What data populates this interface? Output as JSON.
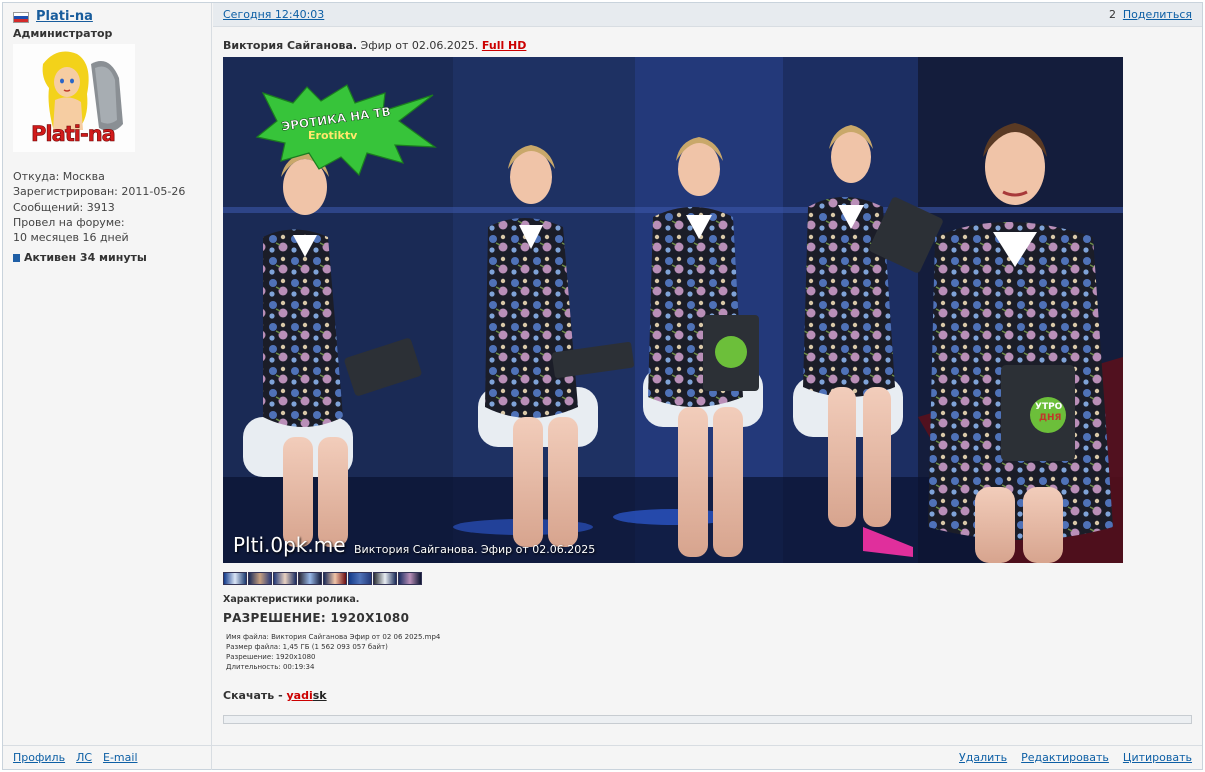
{
  "user": {
    "name": "Plati-na",
    "role": "Администратор",
    "avatar_text": "Plati-na",
    "info": [
      "Откуда: Москва",
      "Зарегистрирован: 2011-05-26",
      "Сообщений: 3913",
      "Провел на форуме:",
      "10 месяцев 16 дней"
    ],
    "active": "Активен 34 минуты"
  },
  "post": {
    "date": "Сегодня 12:40:03",
    "number": "2",
    "share": "Поделиться",
    "title_bold": "Виктория Сайганова.",
    "title_rest": " Эфир от 02.06.2025. ",
    "title_hd": "Full HD",
    "video": {
      "logo_top": "ЭРОТИКА НА ТВ",
      "logo_bottom": "Erotiktv",
      "watermark": "Plti.0pk.me",
      "caption": "Виктория Сайганова. Эфир от 02.06.2025",
      "tablet_text_1": "УТРО",
      "tablet_text_2": "ДНЯ"
    },
    "specs_heading": "Характеристики ролика.",
    "specs_resolution": "РАЗРЕШЕНИЕ: 1920X1080",
    "specs_lines": [
      "Имя файла: Виктория Сайганова Эфир от 02 06 2025.mp4",
      "Размер файла: 1,45 ГБ (1 562 093 057 байт)",
      "Разрешение: 1920x1080",
      "Длительность: 00:19:34"
    ],
    "download_label": "Скачать - ",
    "download_link_a": "yadi",
    "download_link_b": "sk"
  },
  "footer": {
    "left": [
      "Профиль",
      "ЛС",
      "E-mail"
    ],
    "right": [
      "Удалить",
      "Редактировать",
      "Цитировать"
    ]
  },
  "colors": {
    "link": "#0d5fa5",
    "accent_red": "#cc0000",
    "header_bg": "#e7ebef",
    "panel_bg": "#f5f5f5"
  }
}
